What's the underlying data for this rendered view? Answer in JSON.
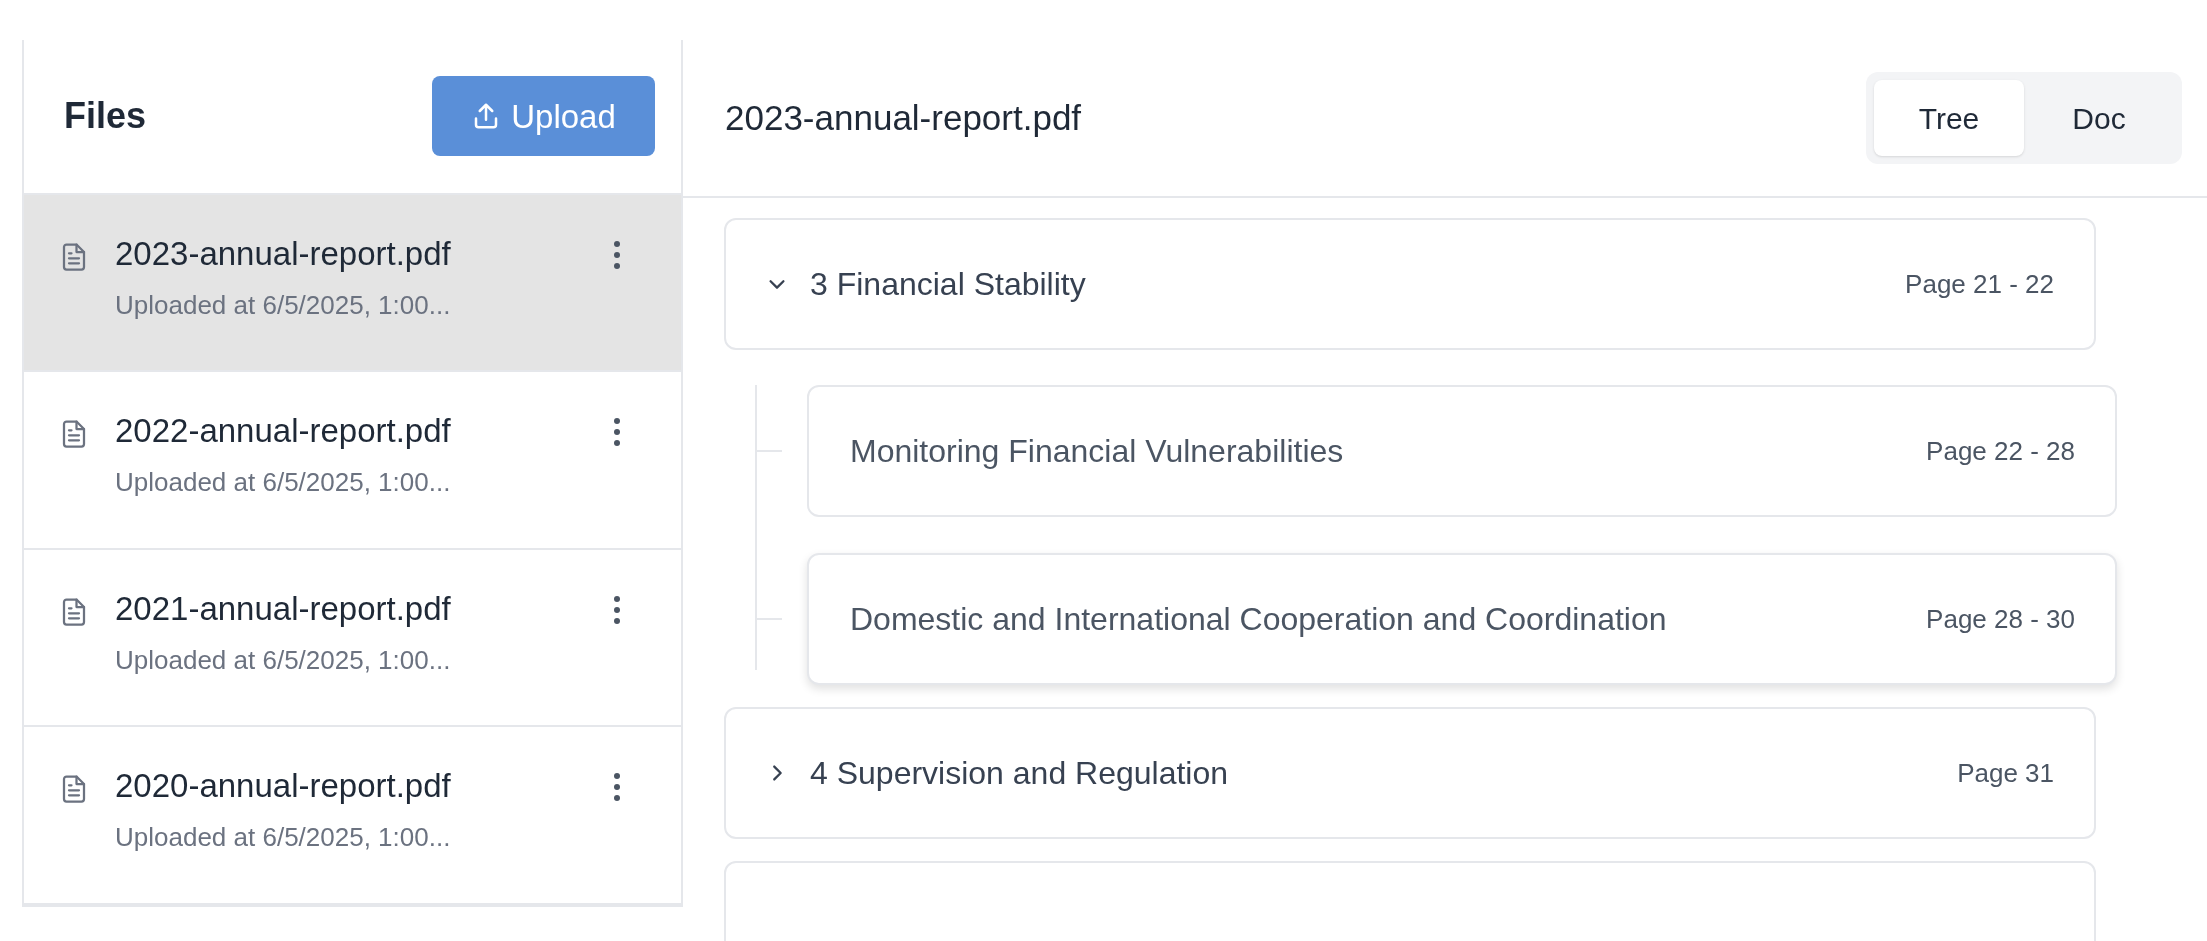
{
  "sidebar": {
    "title": "Files",
    "upload_button": "Upload",
    "files": [
      {
        "name": "2023-annual-report.pdf",
        "subtitle": "Uploaded at 6/5/2025, 1:00...",
        "selected": true
      },
      {
        "name": "2022-annual-report.pdf",
        "subtitle": "Uploaded at 6/5/2025, 1:00...",
        "selected": false
      },
      {
        "name": "2021-annual-report.pdf",
        "subtitle": "Uploaded at 6/5/2025, 1:00...",
        "selected": false
      },
      {
        "name": "2020-annual-report.pdf",
        "subtitle": "Uploaded at 6/5/2025, 1:00...",
        "selected": false
      }
    ]
  },
  "main": {
    "title": "2023-annual-report.pdf",
    "view_toggle": [
      {
        "label": "Tree",
        "selected": true
      },
      {
        "label": "Doc",
        "selected": false
      }
    ],
    "sections": [
      {
        "title": "3 Financial Stability",
        "pages": "Page 21 - 22",
        "expanded": true,
        "children": [
          {
            "title": "Monitoring Financial Vulnerabilities",
            "pages": "Page 22 - 28",
            "hovered": false
          },
          {
            "title": "Domestic and International Cooperation and Coordination",
            "pages": "Page 28 - 30",
            "hovered": true
          }
        ]
      },
      {
        "title": "4 Supervision and Regulation",
        "pages": "Page 31",
        "expanded": false
      }
    ]
  }
}
